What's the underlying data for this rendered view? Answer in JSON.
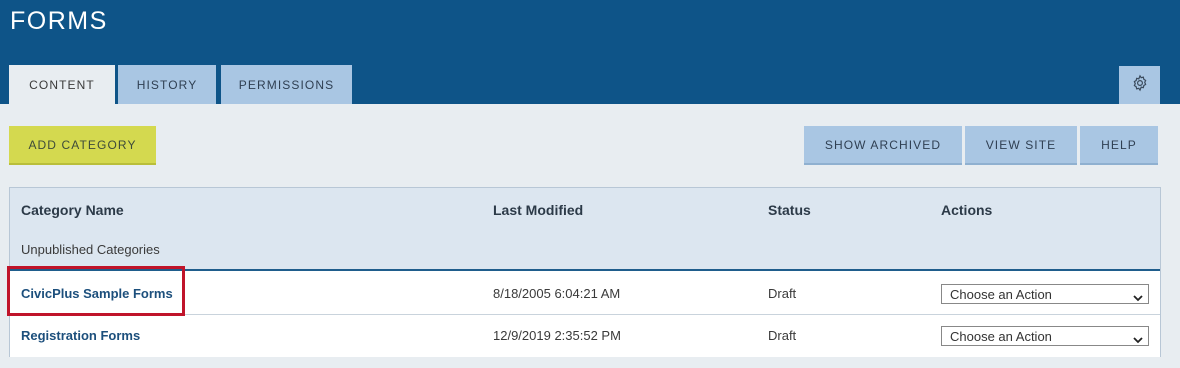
{
  "page": {
    "title": "FORMS"
  },
  "tabs": [
    {
      "label": "CONTENT",
      "active": true
    },
    {
      "label": "HISTORY",
      "active": false
    },
    {
      "label": "PERMISSIONS",
      "active": false
    }
  ],
  "toolbar": {
    "add_category": "ADD CATEGORY",
    "show_archived": "SHOW ARCHIVED",
    "view_site": "VIEW SITE",
    "help": "HELP"
  },
  "table": {
    "headers": [
      "Category Name",
      "Last Modified",
      "Status",
      "Actions"
    ],
    "group_label": "Unpublished Categories",
    "rows": [
      {
        "name": "CivicPlus Sample Forms",
        "modified": "8/18/2005 6:04:21 AM",
        "status": "Draft",
        "action": "Choose an Action"
      },
      {
        "name": "Registration Forms",
        "modified": "12/9/2019 2:35:52 PM",
        "status": "Draft",
        "action": "Choose an Action"
      }
    ]
  },
  "icons": {
    "settings": "gear-icon",
    "dropdown": "chevron-down-icon"
  },
  "colors": {
    "header": "#0e5488",
    "tab": "#a9c6e3",
    "add_button": "#d4d94f",
    "highlight": "#c0142a",
    "link": "#1c4f7c"
  }
}
